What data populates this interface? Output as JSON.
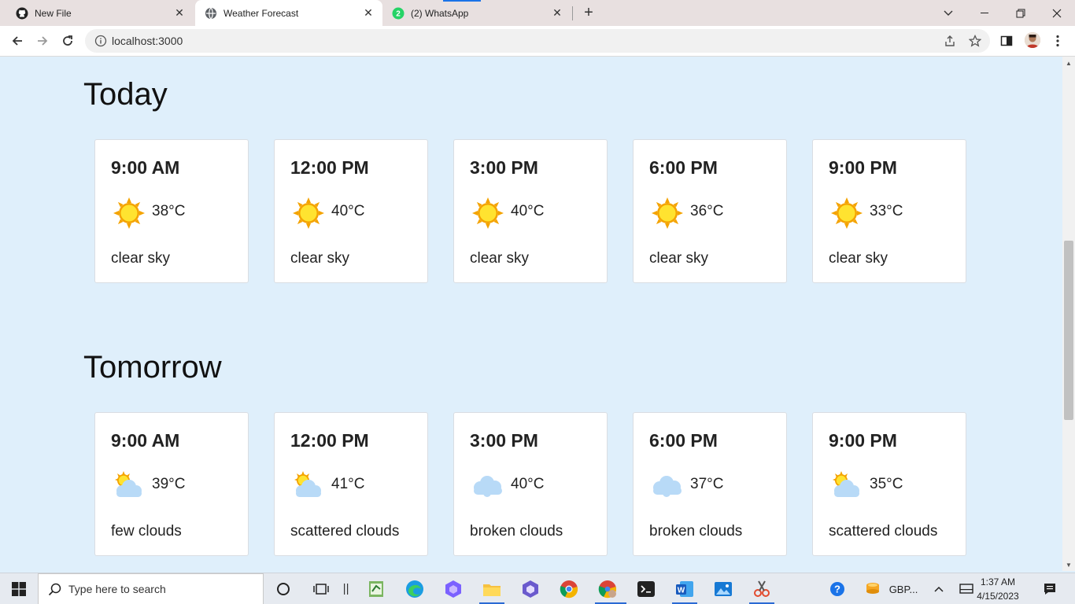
{
  "browser": {
    "tabs": [
      {
        "title": "New File",
        "icon": "github-icon",
        "active": false
      },
      {
        "title": "Weather Forecast",
        "icon": "globe-icon",
        "active": true
      },
      {
        "title": "(2) WhatsApp",
        "icon": "whatsapp-icon",
        "active": false
      }
    ],
    "url": "localhost:3000"
  },
  "sections": [
    {
      "title": "Today",
      "cards": [
        {
          "time": "9:00 AM",
          "temp": "38°C",
          "desc": "clear sky",
          "icon": "sun-icon"
        },
        {
          "time": "12:00 PM",
          "temp": "40°C",
          "desc": "clear sky",
          "icon": "sun-icon"
        },
        {
          "time": "3:00 PM",
          "temp": "40°C",
          "desc": "clear sky",
          "icon": "sun-icon"
        },
        {
          "time": "6:00 PM",
          "temp": "36°C",
          "desc": "clear sky",
          "icon": "sun-icon"
        },
        {
          "time": "9:00 PM",
          "temp": "33°C",
          "desc": "clear sky",
          "icon": "sun-icon"
        }
      ]
    },
    {
      "title": "Tomorrow",
      "cards": [
        {
          "time": "9:00 AM",
          "temp": "39°C",
          "desc": "few clouds",
          "icon": "sun-cloud-icon"
        },
        {
          "time": "12:00 PM",
          "temp": "41°C",
          "desc": "scattered clouds",
          "icon": "sun-cloud-icon"
        },
        {
          "time": "3:00 PM",
          "temp": "40°C",
          "desc": "broken clouds",
          "icon": "cloud-icon"
        },
        {
          "time": "6:00 PM",
          "temp": "37°C",
          "desc": "broken clouds",
          "icon": "cloud-icon"
        },
        {
          "time": "9:00 PM",
          "temp": "35°C",
          "desc": "scattered clouds",
          "icon": "sun-cloud-icon"
        }
      ]
    }
  ],
  "taskbar": {
    "search_placeholder": "Type here to search",
    "tray_label": "GBP...",
    "time": "1:37 AM",
    "date": "4/15/2023"
  },
  "colors": {
    "page_bg": "#dfeffb",
    "card_bg": "#ffffff",
    "sun": "#ffd21f",
    "sun_ray": "#f4a300",
    "cloud": "#b8daf7"
  }
}
